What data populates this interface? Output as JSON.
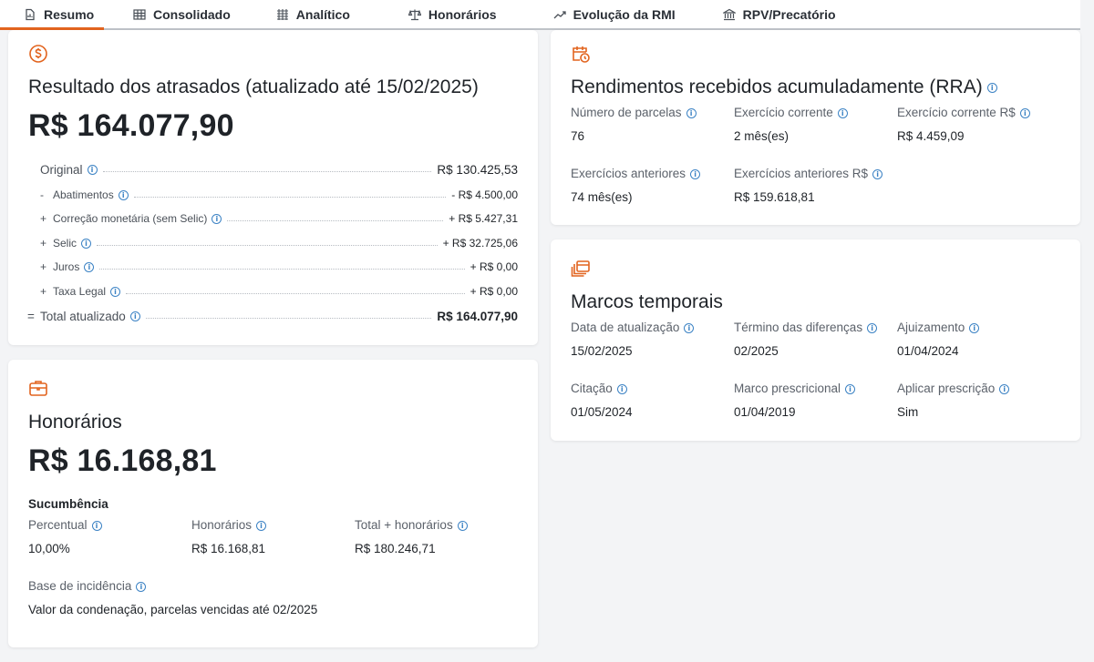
{
  "tabs": [
    {
      "label": "Resumo",
      "icon": "document-chart-icon",
      "active": true
    },
    {
      "label": "Consolidado",
      "icon": "table-icon"
    },
    {
      "label": "Analítico",
      "icon": "grid-icon"
    },
    {
      "label": "Honorários",
      "icon": "scale-icon"
    },
    {
      "label": "Evolução da RMI",
      "icon": "trend-icon"
    },
    {
      "label": "RPV/Precatório",
      "icon": "bank-icon"
    }
  ],
  "atrasados": {
    "title": "Resultado dos atrasados (atualizado até 15/02/2025)",
    "amount": "R$ 164.077,90",
    "rows": [
      {
        "sign": "",
        "label": "Original",
        "value": "R$ 130.425,53"
      },
      {
        "sign": "-",
        "label": "Abatimentos",
        "value": "- R$ 4.500,00"
      },
      {
        "sign": "+",
        "label": "Correção monetária (sem Selic)",
        "value": "+ R$ 5.427,31"
      },
      {
        "sign": "+",
        "label": "Selic",
        "value": "+ R$ 32.725,06"
      },
      {
        "sign": "+",
        "label": "Juros",
        "value": "+ R$ 0,00"
      },
      {
        "sign": "+",
        "label": "Taxa Legal",
        "value": "+ R$ 0,00"
      },
      {
        "sign": "=",
        "label": "Total atualizado",
        "value": "R$ 164.077,90"
      }
    ]
  },
  "honorarios": {
    "title": "Honorários",
    "amount": "R$ 16.168,81",
    "section": "Sucumbência",
    "fields": [
      {
        "label": "Percentual",
        "value": "10,00%"
      },
      {
        "label": "Honorários",
        "value": "R$ 16.168,81"
      },
      {
        "label": "Total + honorários",
        "value": "R$ 180.246,71"
      }
    ],
    "base_label": "Base de incidência",
    "base_value": "Valor da condenação, parcelas vencidas até 02/2025"
  },
  "rra": {
    "title": "Rendimentos recebidos acumuladamente (RRA)",
    "fields": [
      {
        "label": "Número de parcelas",
        "value": "76"
      },
      {
        "label": "Exercício corrente",
        "value": "2 mês(es)"
      },
      {
        "label": "Exercício corrente R$",
        "value": "R$ 4.459,09"
      },
      {
        "label": "Exercícios anteriores",
        "value": "74 mês(es)"
      },
      {
        "label": "Exercícios anteriores R$",
        "value": "R$ 159.618,81"
      }
    ]
  },
  "marcos": {
    "title": "Marcos temporais",
    "fields": [
      {
        "label": "Data de atualização",
        "value": "15/02/2025"
      },
      {
        "label": "Término das diferenças",
        "value": "02/2025"
      },
      {
        "label": "Ajuizamento",
        "value": "01/04/2024"
      },
      {
        "label": "Citação",
        "value": "01/05/2024"
      },
      {
        "label": "Marco prescricional",
        "value": "01/04/2019"
      },
      {
        "label": "Aplicar prescrição",
        "value": "Sim"
      }
    ]
  },
  "colors": {
    "accent": "#e2641f",
    "info": "#3b82c4"
  }
}
